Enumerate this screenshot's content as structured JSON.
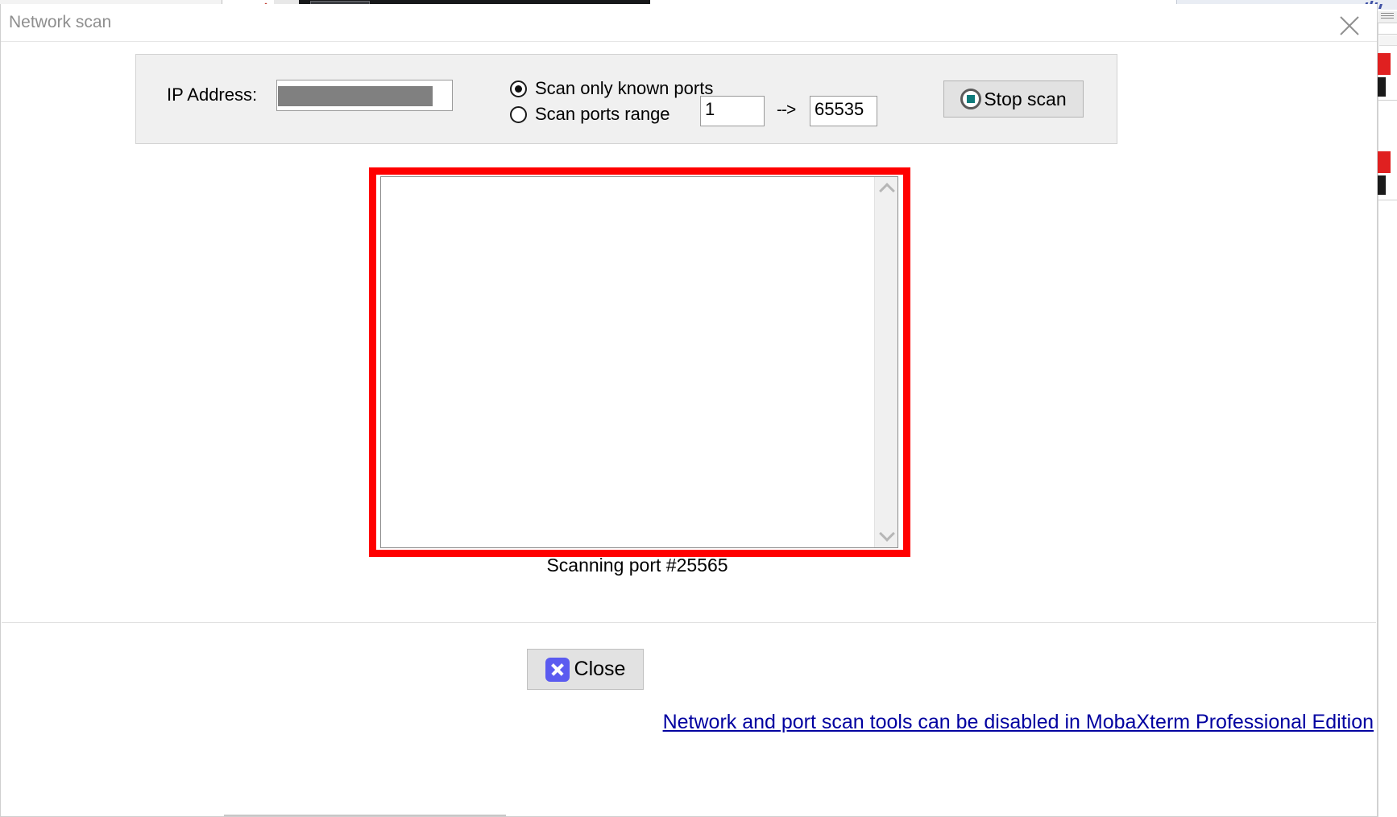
{
  "window": {
    "title": "Network scan",
    "close_icon": "close-x-icon"
  },
  "scan_settings": {
    "ip_label": "IP Address:",
    "ip_value": "",
    "ip_redacted": true,
    "radio_known_label": "Scan only known ports",
    "radio_known_selected": true,
    "radio_range_label": "Scan ports range",
    "radio_range_selected": false,
    "port_from": "1",
    "port_arrow": "-->",
    "port_to": "65535",
    "stop_button_label": "Stop scan",
    "stop_button_icon": "stop-record-icon"
  },
  "results": {
    "items": [],
    "scrollbar": {
      "up_icon": "chevron-up-icon",
      "down_icon": "chevron-down-icon"
    },
    "annotation_color": "#ff0000"
  },
  "status": {
    "text": "Scanning port #25565"
  },
  "footer": {
    "close_label": "Close",
    "close_icon": "close-square-icon",
    "promo_link": "Network and port scan tools can be disabled in MobaXterm Professional Edition"
  },
  "colors": {
    "accent_red": "#ff0000",
    "stop_teal": "#0f7b7b",
    "close_blue": "#5b5bf0",
    "link_navy": "#0000a0",
    "panel_grey": "#f0f0f0"
  }
}
